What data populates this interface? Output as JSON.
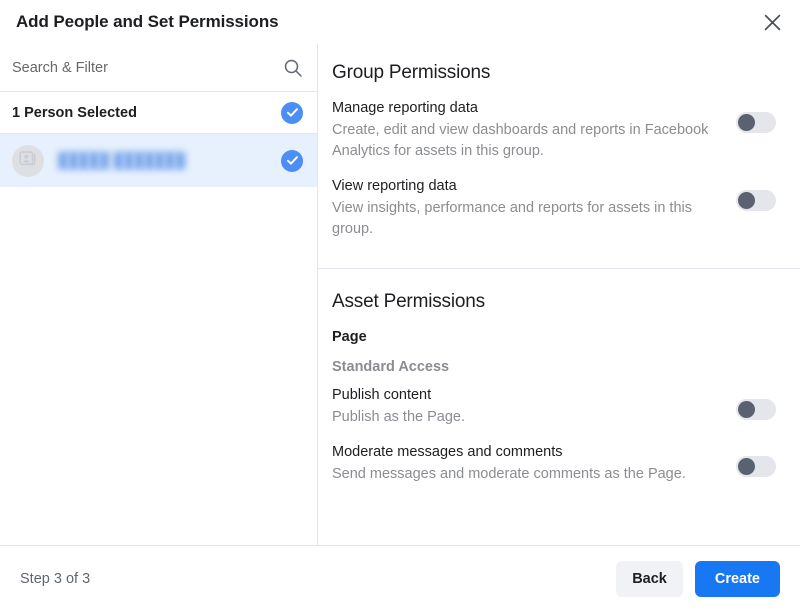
{
  "dialog": {
    "title": "Add People and Set Permissions",
    "close_icon": "close-icon"
  },
  "left_panel": {
    "search": {
      "placeholder": "Search & Filter",
      "value": "",
      "icon": "search-icon"
    },
    "selected_header": {
      "label": "1 Person Selected",
      "checked": true,
      "check_icon": "check-circle-icon"
    },
    "people": [
      {
        "name": "",
        "redacted": true,
        "avatar_icon": "contact-card-icon",
        "checked": true,
        "check_icon": "check-circle-icon"
      }
    ]
  },
  "right_panel": {
    "group_permissions": {
      "title": "Group Permissions",
      "items": [
        {
          "label": "Manage reporting data",
          "description": "Create, edit and view dashboards and reports in Facebook Analytics for assets in this group.",
          "toggle_on": false
        },
        {
          "label": "View reporting data",
          "description": "View insights, performance and reports for assets in this group.",
          "toggle_on": false
        }
      ]
    },
    "asset_permissions": {
      "title": "Asset Permissions",
      "asset_type": "Page",
      "access_level": "Standard Access",
      "items": [
        {
          "label": "Publish content",
          "description": "Publish as the Page.",
          "toggle_on": false
        },
        {
          "label": "Moderate messages and comments",
          "description": "Send messages and moderate comments as the Page.",
          "toggle_on": false
        }
      ]
    }
  },
  "footer": {
    "step_label": "Step 3 of 3",
    "back_label": "Back",
    "create_label": "Create"
  },
  "colors": {
    "accent_blue": "#1877f2",
    "check_blue": "#4b8ef5",
    "selected_row_bg": "#e7f1fd",
    "toggle_track": "#e4e6eb",
    "toggle_knob": "#5a6170",
    "divider": "#e4e6eb",
    "text_primary": "#1c1e21",
    "text_secondary": "#8a8d91",
    "button_secondary_bg": "#f0f2f5"
  }
}
